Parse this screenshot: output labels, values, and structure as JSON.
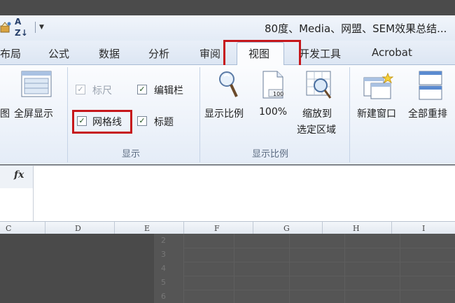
{
  "window": {
    "title": "80度、Media、网盟、SEM效果总结..."
  },
  "quick_access": {
    "sort_label": "A Z↓",
    "dropdown_glyph": "▼"
  },
  "tabs": [
    {
      "label": "布局"
    },
    {
      "label": "公式"
    },
    {
      "label": "数据"
    },
    {
      "label": "分析"
    },
    {
      "label": "审阅"
    },
    {
      "label": "视图"
    },
    {
      "label": "开发工具"
    },
    {
      "label": "Acrobat"
    }
  ],
  "ribbon": {
    "view_cut_label": "图",
    "fullscreen_label": "全屏显示",
    "show_group": {
      "label": "显示",
      "ruler": {
        "label": "标尺",
        "checked": true,
        "enabled": false
      },
      "formula_bar": {
        "label": "编辑栏",
        "checked": true
      },
      "gridlines": {
        "label": "网格线",
        "checked": true
      },
      "headings": {
        "label": "标题",
        "checked": true
      }
    },
    "zoom_group": {
      "label": "显示比例",
      "zoom_label": "显示比例",
      "hundred_label": "100%",
      "hundred_icon_text": "100",
      "zoom_selection_line1": "缩放到",
      "zoom_selection_line2": "选定区域"
    },
    "window_group": {
      "new_window_label": "新建窗口",
      "arrange_all_label": "全部重排"
    }
  },
  "formula_bar": {
    "fx_label": "fx",
    "value": ""
  },
  "sheet": {
    "columns": [
      "C",
      "D",
      "E",
      "F",
      "G",
      "H",
      "I"
    ],
    "rows": [
      "2",
      "3",
      "4",
      "5",
      "6"
    ]
  },
  "colors": {
    "highlight": "#c6171b",
    "ribbon_bg": "#e4ecf7"
  }
}
